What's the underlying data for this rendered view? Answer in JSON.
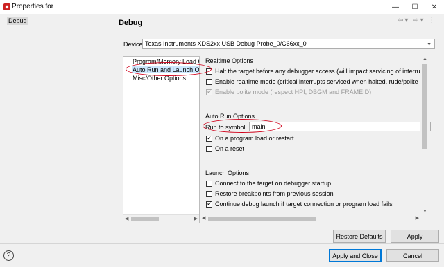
{
  "window": {
    "title": "Properties for",
    "controls": [
      "—",
      "☐",
      "✕"
    ]
  },
  "sidebar": {
    "items": [
      {
        "label": "Debug"
      }
    ]
  },
  "header": {
    "title": "Debug",
    "nav_icons": [
      "back-icon",
      "forward-icon",
      "more-icon"
    ]
  },
  "device": {
    "label": "Device",
    "value": "Texas Instruments XDS2xx USB Debug Probe_0/C66xx_0"
  },
  "tree": {
    "items": [
      {
        "label": "Program/Memory Load O",
        "selected": false
      },
      {
        "label": "Auto Run and Launch Op",
        "selected": true
      },
      {
        "label": "Misc/Other Options",
        "selected": false
      }
    ]
  },
  "realtime": {
    "title": "Realtime Options",
    "options": [
      {
        "label": "Halt the target before any debugger access (will impact servicing of interrupts",
        "checked": false,
        "disabled": false
      },
      {
        "label": "Enable realtime mode (critical interrupts serviced when halted, rude/polite mo",
        "checked": false,
        "disabled": false
      },
      {
        "label": "Enable polite mode (respect HPI, DBGM and FRAMEID)",
        "checked": true,
        "disabled": true
      }
    ]
  },
  "autorun": {
    "title": "Auto Run Options",
    "run_label": "Run to symbol",
    "run_value": "main",
    "options": [
      {
        "label": "On a program load or restart",
        "checked": true
      },
      {
        "label": "On a reset",
        "checked": false
      }
    ]
  },
  "launch": {
    "title": "Launch Options",
    "options": [
      {
        "label": "Connect to the target on debugger startup",
        "checked": false
      },
      {
        "label": "Restore breakpoints from previous session",
        "checked": false
      },
      {
        "label": "Continue debug launch if target connection or program load fails",
        "checked": true
      }
    ]
  },
  "buttons": {
    "restore_defaults": "Restore Defaults",
    "apply": "Apply",
    "apply_and_close": "Apply and Close",
    "cancel": "Cancel"
  },
  "help_icon": "?",
  "colors": {
    "annotation": "#d0021b",
    "selection": "#cce8ff",
    "primary_border": "#0078d7"
  }
}
